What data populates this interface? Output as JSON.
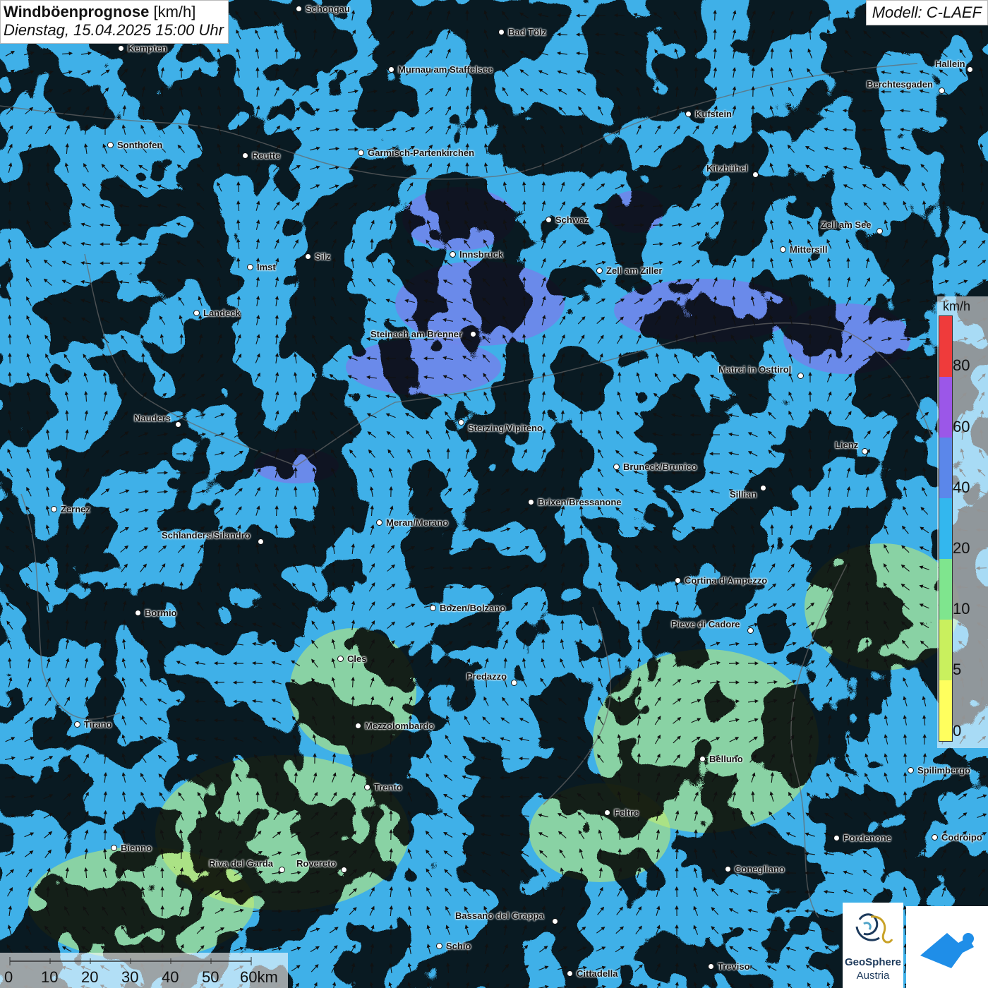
{
  "title": {
    "bold": "Windböenprognose",
    "unit": " [km/h]",
    "date": "Dienstag, 15.04.2025 15:00 Uhr"
  },
  "model": "Modell: C-LAEF",
  "legend": {
    "unit": "km/h",
    "labels": [
      "80",
      "60",
      "40",
      "20",
      "10",
      "5",
      "0"
    ],
    "colors": [
      "#ef3b3b",
      "#9b57e8",
      "#5b87ea",
      "#33b7ee",
      "#7fe58e",
      "#c9f05e",
      "#ffff5e"
    ]
  },
  "scale": {
    "labels": [
      "0",
      "10",
      "20",
      "30",
      "40",
      "50",
      "60km"
    ]
  },
  "logo": {
    "line1": "GeoSphere",
    "line2": "Austria",
    "app_icon": "wind-app-icon"
  },
  "cities": [
    {
      "name": "Schongau",
      "dot": [
        424,
        13
      ],
      "lbl": [
        433,
        13
      ]
    },
    {
      "name": "Bad Tölz",
      "dot": [
        711,
        46
      ],
      "lbl": [
        720,
        46
      ]
    },
    {
      "name": "Kempten",
      "dot": [
        172,
        69
      ],
      "lbl": [
        181,
        69
      ]
    },
    {
      "name": "Murnau am Staffelsee",
      "dot": [
        555,
        99
      ],
      "lbl": [
        564,
        99
      ]
    },
    {
      "name": "Hallein",
      "dot": [
        1375,
        99
      ],
      "lbl": [
        1325,
        91
      ]
    },
    {
      "name": "Berchtesgaden",
      "dot": [
        1335,
        129
      ],
      "lbl": [
        1228,
        120
      ]
    },
    {
      "name": "Kufstein",
      "dot": [
        976,
        162
      ],
      "lbl": [
        985,
        162
      ]
    },
    {
      "name": "Sonthofen",
      "dot": [
        157,
        206
      ],
      "lbl": [
        166,
        206
      ]
    },
    {
      "name": "Reutte",
      "dot": [
        348,
        221
      ],
      "lbl": [
        357,
        221
      ]
    },
    {
      "name": "Garmisch-Partenkirchen",
      "dot": [
        512,
        217
      ],
      "lbl": [
        521,
        217
      ]
    },
    {
      "name": "Kitzbühel",
      "dot": [
        1071,
        248
      ],
      "lbl": [
        1001,
        239
      ]
    },
    {
      "name": "Schwaz",
      "dot": [
        778,
        312
      ],
      "lbl": [
        787,
        312
      ]
    },
    {
      "name": "Zell am See",
      "dot": [
        1247,
        328
      ],
      "lbl": [
        1163,
        319
      ]
    },
    {
      "name": "Mittersill",
      "dot": [
        1110,
        354
      ],
      "lbl": [
        1119,
        354
      ]
    },
    {
      "name": "Innsbruck",
      "dot": [
        642,
        361
      ],
      "lbl": [
        651,
        361
      ]
    },
    {
      "name": "Silz",
      "dot": [
        437,
        364
      ],
      "lbl": [
        446,
        364
      ]
    },
    {
      "name": "Imst",
      "dot": [
        355,
        379
      ],
      "lbl": [
        364,
        379
      ]
    },
    {
      "name": "Zell am Ziller",
      "dot": [
        850,
        384
      ],
      "lbl": [
        859,
        384
      ]
    },
    {
      "name": "Landeck",
      "dot": [
        279,
        444
      ],
      "lbl": [
        288,
        444
      ]
    },
    {
      "name": "Steinach am Brenner",
      "dot": [
        671,
        474
      ],
      "lbl": [
        525,
        474
      ]
    },
    {
      "name": "Matrei in Osttirol",
      "dot": [
        1135,
        533
      ],
      "lbl": [
        1018,
        524
      ]
    },
    {
      "name": "Nauders",
      "dot": [
        253,
        602
      ],
      "lbl": [
        190,
        593
      ]
    },
    {
      "name": "Sterzing/Vipiteno",
      "dot": [
        654,
        599
      ],
      "lbl": [
        663,
        607
      ]
    },
    {
      "name": "Lienz",
      "dot": [
        1226,
        640
      ],
      "lbl": [
        1183,
        631
      ]
    },
    {
      "name": "Bruneck/Brunico",
      "dot": [
        874,
        662
      ],
      "lbl": [
        883,
        662
      ]
    },
    {
      "name": "Sillian",
      "dot": [
        1082,
        692
      ],
      "lbl": [
        1034,
        701
      ]
    },
    {
      "name": "Brixen/Bressanone",
      "dot": [
        753,
        712
      ],
      "lbl": [
        762,
        712
      ]
    },
    {
      "name": "Zernez",
      "dot": [
        77,
        722
      ],
      "lbl": [
        86,
        722
      ]
    },
    {
      "name": "Meran/Merano",
      "dot": [
        538,
        741
      ],
      "lbl": [
        547,
        741
      ]
    },
    {
      "name": "Schlanders/Silandro",
      "dot": [
        370,
        768
      ],
      "lbl": [
        229,
        759
      ]
    },
    {
      "name": "Cortina d'Ampezzo",
      "dot": [
        961,
        823
      ],
      "lbl": [
        970,
        823
      ]
    },
    {
      "name": "Bozen/Bolzano",
      "dot": [
        614,
        862
      ],
      "lbl": [
        623,
        862
      ]
    },
    {
      "name": "Bormio",
      "dot": [
        196,
        869
      ],
      "lbl": [
        205,
        869
      ]
    },
    {
      "name": "Pieve di Cadore",
      "dot": [
        1064,
        894
      ],
      "lbl": [
        951,
        885
      ]
    },
    {
      "name": "Cles",
      "dot": [
        483,
        934
      ],
      "lbl": [
        492,
        934
      ]
    },
    {
      "name": "Predazzo",
      "dot": [
        729,
        968
      ],
      "lbl": [
        661,
        959
      ]
    },
    {
      "name": "Tirano",
      "dot": [
        110,
        1027
      ],
      "lbl": [
        119,
        1027
      ]
    },
    {
      "name": "Mezzolombardo",
      "dot": [
        508,
        1029
      ],
      "lbl": [
        517,
        1029
      ]
    },
    {
      "name": "Belluno",
      "dot": [
        996,
        1076
      ],
      "lbl": [
        1005,
        1076
      ]
    },
    {
      "name": "Spilimbergo",
      "dot": [
        1291,
        1092
      ],
      "lbl": [
        1300,
        1092
      ]
    },
    {
      "name": "Trento",
      "dot": [
        521,
        1116
      ],
      "lbl": [
        530,
        1116
      ]
    },
    {
      "name": "Feltre",
      "dot": [
        861,
        1152
      ],
      "lbl": [
        870,
        1152
      ]
    },
    {
      "name": "Pordenone",
      "dot": [
        1186,
        1188
      ],
      "lbl": [
        1195,
        1188
      ]
    },
    {
      "name": "Codroipo",
      "dot": [
        1325,
        1187
      ],
      "lbl": [
        1334,
        1187
      ]
    },
    {
      "name": "Bienno",
      "dot": [
        162,
        1202
      ],
      "lbl": [
        171,
        1202
      ]
    },
    {
      "name": "Riva del Garda",
      "dot": [
        400,
        1233
      ],
      "lbl": [
        296,
        1224
      ]
    },
    {
      "name": "Rovereto",
      "dot": [
        488,
        1233
      ],
      "lbl": [
        420,
        1224
      ]
    },
    {
      "name": "Conegliano",
      "dot": [
        1032,
        1232
      ],
      "lbl": [
        1041,
        1232
      ]
    },
    {
      "name": "Bassano del Grappa",
      "dot": [
        787,
        1306
      ],
      "lbl": [
        645,
        1298
      ]
    },
    {
      "name": "Schio",
      "dot": [
        623,
        1341
      ],
      "lbl": [
        632,
        1341
      ]
    },
    {
      "name": "Treviso",
      "dot": [
        1008,
        1370
      ],
      "lbl": [
        1017,
        1370
      ]
    },
    {
      "name": "Cittadella",
      "dot": [
        808,
        1380
      ],
      "lbl": [
        817,
        1380
      ]
    }
  ]
}
